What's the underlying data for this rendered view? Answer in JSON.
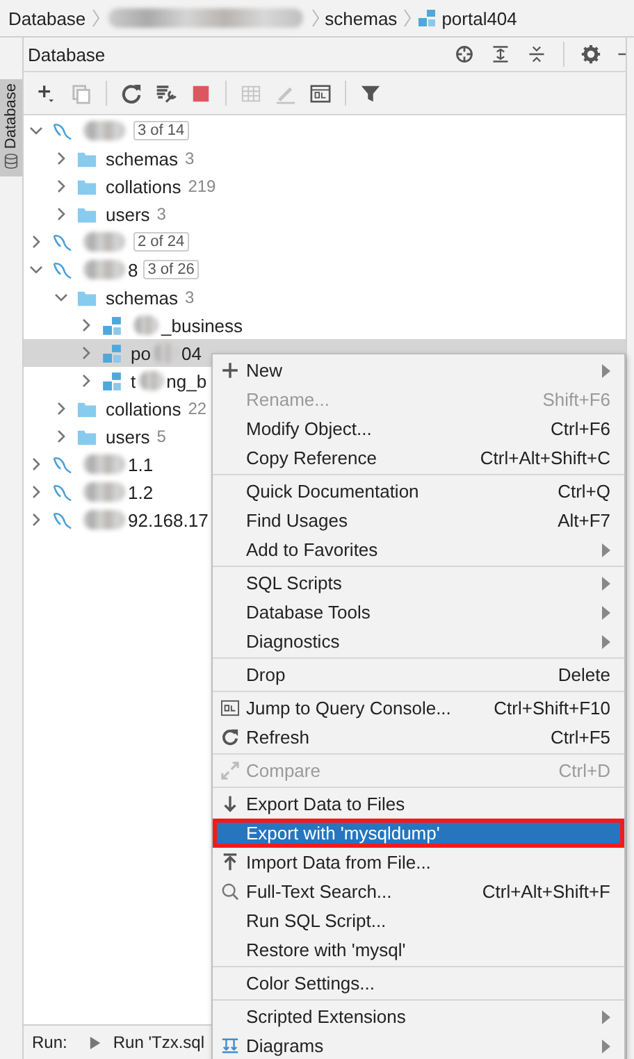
{
  "breadcrumb": {
    "items": [
      {
        "kind": "text",
        "label": "Database"
      },
      {
        "kind": "redacted"
      },
      {
        "kind": "text",
        "label": "schemas"
      },
      {
        "kind": "schema",
        "label": "portal404"
      }
    ]
  },
  "side_tab": {
    "label": "Database",
    "selected": true
  },
  "panel": {
    "title": "Database"
  },
  "tree": [
    {
      "kind": "server",
      "redacted": true,
      "badge": "3 of 14",
      "expanded": true,
      "selected": false,
      "children": [
        {
          "kind": "folder",
          "label": "schemas",
          "count": "3",
          "expanded": false,
          "selected": false
        },
        {
          "kind": "folder",
          "label": "collations",
          "count": "219",
          "expanded": false,
          "selected": false
        },
        {
          "kind": "folder",
          "label": "users",
          "count": "3",
          "expanded": false,
          "selected": false
        }
      ]
    },
    {
      "kind": "server",
      "redacted": true,
      "badge": "2 of 24",
      "expanded": false,
      "selected": false
    },
    {
      "kind": "server",
      "redacted": true,
      "label": "8",
      "badge": "3 of 26",
      "expanded": true,
      "selected": false,
      "children": [
        {
          "kind": "folder",
          "label": "schemas",
          "count": "3",
          "expanded": true,
          "selected": false,
          "children": [
            {
              "kind": "schema",
              "redacted": true,
              "label": "_business",
              "expanded": false,
              "selected": false
            },
            {
              "kind": "schema",
              "prefix": "po",
              "redacted": true,
              "label": "04",
              "expanded": false,
              "selected": true
            },
            {
              "kind": "schema",
              "prefix": "t",
              "redacted": true,
              "label": "ng_b",
              "expanded": false,
              "selected": false
            }
          ]
        },
        {
          "kind": "folder",
          "label": "collations",
          "count": "22",
          "expanded": false,
          "selected": false
        },
        {
          "kind": "folder",
          "label": "users",
          "count": "5",
          "expanded": false,
          "selected": false
        }
      ]
    },
    {
      "kind": "server",
      "redacted": true,
      "label": "1.1",
      "expanded": false,
      "selected": false
    },
    {
      "kind": "server",
      "redacted": true,
      "label": "1.2",
      "expanded": false,
      "selected": false
    },
    {
      "kind": "server",
      "redacted": true,
      "label": "92.168.17",
      "expanded": false,
      "selected": false
    }
  ],
  "run_bar": {
    "label": "Run:",
    "tab": "Run 'Tzx.sql"
  },
  "context_menu": {
    "groups": [
      [
        {
          "kind": "new",
          "label": "New",
          "submenu": true,
          "disabled": false,
          "selected": false
        },
        {
          "kind": "plain",
          "label": "Rename...",
          "shortcut": "Shift+F6",
          "disabled": true,
          "selected": false
        },
        {
          "kind": "plain",
          "label": "Modify Object...",
          "shortcut": "Ctrl+F6",
          "disabled": false,
          "selected": false
        },
        {
          "kind": "plain",
          "label": "Copy Reference",
          "shortcut": "Ctrl+Alt+Shift+C",
          "disabled": false,
          "selected": false
        }
      ],
      [
        {
          "kind": "plain",
          "label": "Quick Documentation",
          "shortcut": "Ctrl+Q",
          "disabled": false,
          "selected": false
        },
        {
          "kind": "plain",
          "label": "Find Usages",
          "shortcut": "Alt+F7",
          "disabled": false,
          "selected": false
        },
        {
          "kind": "plain",
          "label": "Add to Favorites",
          "submenu": true,
          "disabled": false,
          "selected": false
        }
      ],
      [
        {
          "kind": "plain",
          "label": "SQL Scripts",
          "submenu": true,
          "disabled": false,
          "selected": false
        },
        {
          "kind": "plain",
          "label": "Database Tools",
          "submenu": true,
          "disabled": false,
          "selected": false
        },
        {
          "kind": "plain",
          "label": "Diagnostics",
          "submenu": true,
          "disabled": false,
          "selected": false
        }
      ],
      [
        {
          "kind": "plain",
          "label": "Drop",
          "shortcut": "Delete",
          "disabled": false,
          "selected": false
        }
      ],
      [
        {
          "kind": "console",
          "label": "Jump to Query Console...",
          "shortcut": "Ctrl+Shift+F10",
          "disabled": false,
          "selected": false
        },
        {
          "kind": "refresh",
          "label": "Refresh",
          "shortcut": "Ctrl+F5",
          "disabled": false,
          "selected": false
        }
      ],
      [
        {
          "kind": "compare",
          "label": "Compare",
          "shortcut": "Ctrl+D",
          "disabled": true,
          "selected": false
        }
      ],
      [
        {
          "kind": "export",
          "label": "Export Data to Files",
          "disabled": false,
          "selected": false
        },
        {
          "kind": "plain",
          "label": "Export with 'mysqldump'",
          "disabled": false,
          "selected": true,
          "annotated": true
        },
        {
          "kind": "import",
          "label": "Import Data from File...",
          "disabled": false,
          "selected": false
        },
        {
          "kind": "search",
          "label": "Full-Text Search...",
          "shortcut": "Ctrl+Alt+Shift+F",
          "disabled": false,
          "selected": false
        },
        {
          "kind": "plain",
          "label": "Run SQL Script...",
          "disabled": false,
          "selected": false
        },
        {
          "kind": "plain",
          "label": "Restore with 'mysql'",
          "disabled": false,
          "selected": false
        }
      ],
      [
        {
          "kind": "plain",
          "label": "Color Settings...",
          "disabled": false,
          "selected": false
        }
      ],
      [
        {
          "kind": "plain",
          "label": "Scripted Extensions",
          "submenu": true,
          "disabled": false,
          "selected": false
        },
        {
          "kind": "diagram",
          "label": "Diagrams",
          "submenu": true,
          "disabled": false,
          "selected": false
        }
      ]
    ]
  }
}
